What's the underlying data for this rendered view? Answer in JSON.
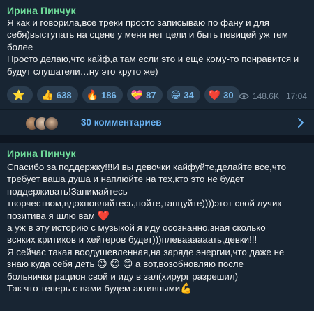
{
  "message1": {
    "author": "Ирина Пинчук",
    "text": "Я как и говорила,все треки просто записываю по фану и для себя)выступать на сцене у меня нет цели и быть певицей уж тем более\nПросто делаю,что кайф,а там если это и ещё кому-то понравится и будут слушатели…ну это круто же)",
    "reactions": [
      {
        "icon": "star-icon",
        "emoji": "⭐",
        "count": ""
      },
      {
        "icon": "thumbs-up-icon",
        "emoji": "👍",
        "count": "638"
      },
      {
        "icon": "fire-icon",
        "emoji": "🔥",
        "count": "186"
      },
      {
        "icon": "heart-box-icon",
        "emoji": "💝",
        "count": "87"
      },
      {
        "icon": "grin-icon",
        "emoji": "😁",
        "count": "34"
      },
      {
        "icon": "heart-icon",
        "emoji": "❤️",
        "count": "30"
      }
    ],
    "views": "148.6K",
    "time": "17:04"
  },
  "comments": {
    "label": "30 комментариев"
  },
  "message2": {
    "author": "Ирина Пинчук",
    "lines": [
      "Спасибо за поддержку!!!И вы девочки кайфуйте,делайте все,что",
      "требует ваша душа и наплюйте на тех,кто это не будет",
      "поддерживать!Занимайтесь",
      "творчеством,вдохновляйтесь,пойте,танцуйте))))этот свой лучик",
      "позитива я шлю вам",
      "а уж в эту историю с музыкой я иду осознанно,зная сколько",
      "всяких критиков и хейтеров будет)))плеваааааать,девки!!!",
      "Я сейчас такая воодушевленная,на заряде энергии,что даже не",
      "знаю куда себя деть",
      "а вот,возобновляю после",
      "больнички рацион свой и иду в зал(хирург разрешил)",
      "Так что теперь с вами будем активными"
    ],
    "heart_emoji": "❤️",
    "grin_emoji": "😊",
    "muscle_emoji": "💪"
  },
  "colors": {
    "background": "#0e1621",
    "bubble": "#182533",
    "author": "#6fdc9a",
    "link": "#6ab3f3",
    "reaction_bg": "#2b3d4f"
  }
}
